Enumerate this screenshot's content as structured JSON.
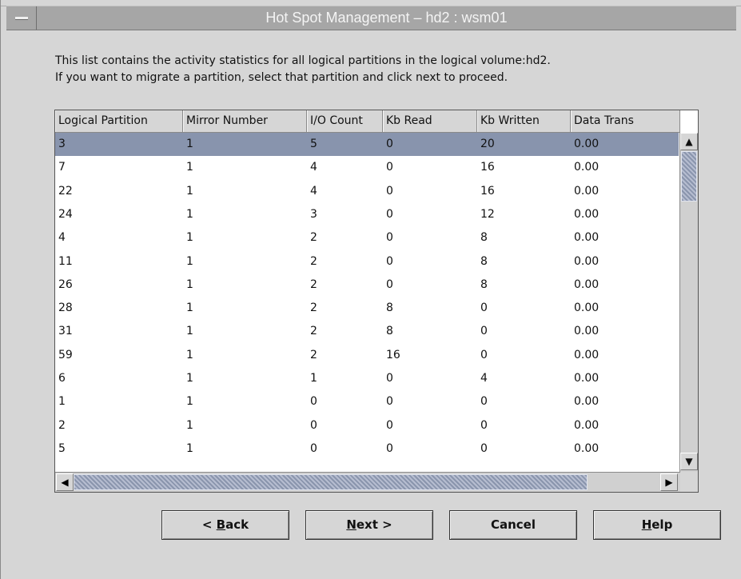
{
  "window": {
    "title": "Hot Spot Management – hd2 : wsm01"
  },
  "intro": {
    "line1": "This list contains the activity statistics for all logical partitions in the logical volume:hd2.",
    "line2": "If you want to migrate a partition, select that partition and click next to proceed."
  },
  "table": {
    "columns": [
      "Logical Partition",
      "Mirror Number",
      "I/O Count",
      "Kb Read",
      "Kb Written",
      "Data Trans"
    ],
    "rows": [
      [
        "3",
        "1",
        "5",
        "0",
        "20",
        "0.00"
      ],
      [
        "7",
        "1",
        "4",
        "0",
        "16",
        "0.00"
      ],
      [
        "22",
        "1",
        "4",
        "0",
        "16",
        "0.00"
      ],
      [
        "24",
        "1",
        "3",
        "0",
        "12",
        "0.00"
      ],
      [
        "4",
        "1",
        "2",
        "0",
        "8",
        "0.00"
      ],
      [
        "11",
        "1",
        "2",
        "0",
        "8",
        "0.00"
      ],
      [
        "26",
        "1",
        "2",
        "0",
        "8",
        "0.00"
      ],
      [
        "28",
        "1",
        "2",
        "8",
        "0",
        "0.00"
      ],
      [
        "31",
        "1",
        "2",
        "8",
        "0",
        "0.00"
      ],
      [
        "59",
        "1",
        "2",
        "16",
        "0",
        "0.00"
      ],
      [
        "6",
        "1",
        "1",
        "0",
        "4",
        "0.00"
      ],
      [
        "1",
        "1",
        "0",
        "0",
        "0",
        "0.00"
      ],
      [
        "2",
        "1",
        "0",
        "0",
        "0",
        "0.00"
      ],
      [
        "5",
        "1",
        "0",
        "0",
        "0",
        "0.00"
      ]
    ],
    "selected_row": 0
  },
  "buttons": {
    "back": {
      "pre": "< ",
      "mnemonic": "B",
      "post": "ack"
    },
    "next": {
      "pre": "",
      "mnemonic": "N",
      "post": "ext >"
    },
    "cancel": {
      "pre": "Cancel",
      "mnemonic": "",
      "post": ""
    },
    "help": {
      "pre": "",
      "mnemonic": "H",
      "post": "elp"
    }
  },
  "icons": {
    "window_menu": "window-menu-icon",
    "scroll_up": "arrow-up-icon",
    "scroll_down": "arrow-down-icon",
    "scroll_left": "arrow-left-icon",
    "scroll_right": "arrow-right-icon"
  },
  "colors": {
    "selection": "#8894ad",
    "titlebar": "#a6a6a6"
  }
}
